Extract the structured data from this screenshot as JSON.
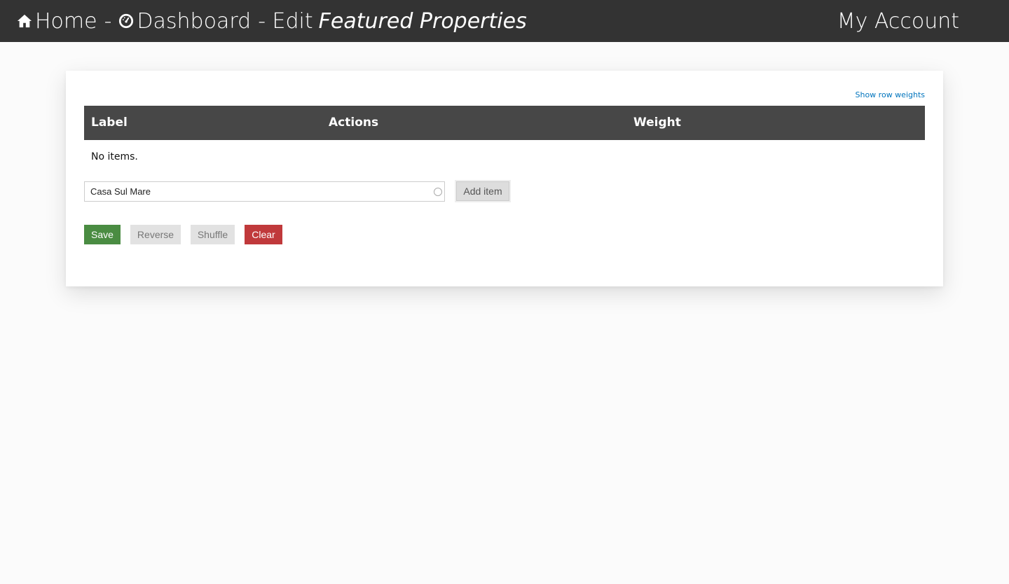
{
  "header": {
    "home_label": "Home",
    "separator": "-",
    "dashboard_label": "Dashboard",
    "edit_label": "- Edit",
    "entity_title": "Featured Properties",
    "account_label": "My Account",
    "background": "#333333"
  },
  "panel": {
    "show_row_weights_link": "Show row weights",
    "table": {
      "columns": [
        "Label",
        "Actions",
        "Weight"
      ],
      "empty_text": "No items."
    },
    "autocomplete": {
      "value": "Casa Sul Mare",
      "placeholder": ""
    },
    "add_item_label": "Add item",
    "buttons": {
      "save": "Save",
      "reverse": "Reverse",
      "shuffle": "Shuffle",
      "clear": "Clear"
    }
  },
  "icons": {
    "home": "home-icon",
    "dashboard": "dashboard-gauge-icon"
  },
  "colors": {
    "save": "#4a8c42",
    "clear": "#c0393b",
    "table_header": "#474747",
    "link": "#0074bd"
  }
}
